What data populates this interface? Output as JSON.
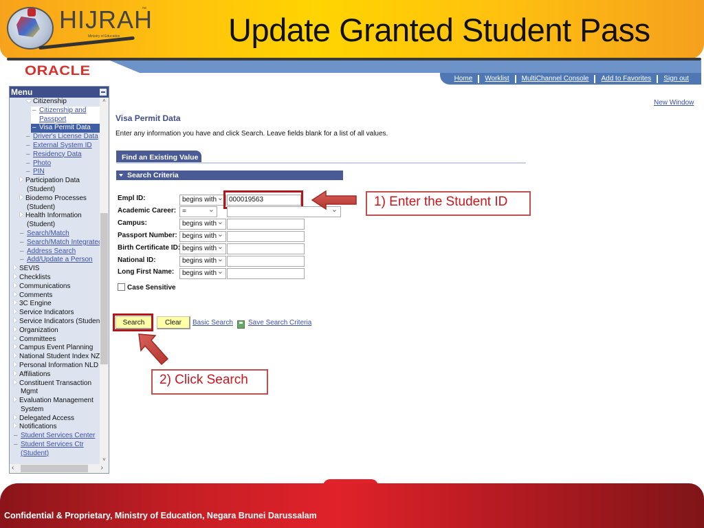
{
  "slide": {
    "title": "Update Granted Student Pass",
    "logo_text": "HIJRAH",
    "logo_tm": "™",
    "logo_subtitle": "Ministry of Education",
    "footer": "Confidential & Proprietary, Ministry of Education, Negara Brunei Darussalam"
  },
  "app": {
    "brand": "ORACLE",
    "nav_links": [
      "Home",
      "Worklist",
      "MultiChannel Console",
      "Add to Favorites",
      "Sign out"
    ],
    "new_window": "New Window"
  },
  "menu": {
    "title": "Menu",
    "items": [
      {
        "label": "Citizenship",
        "type": "open-folder",
        "indent": 2
      },
      {
        "label": "Citizenship and",
        "type": "link",
        "indent": 3,
        "white": true
      },
      {
        "label": "Passport",
        "type": "link-cont",
        "indent": 3,
        "white": true
      },
      {
        "label": "Visa Permit Data",
        "type": "selected",
        "indent": 3
      },
      {
        "label": "Driver's License Data",
        "type": "link",
        "indent": 2
      },
      {
        "label": "External System ID",
        "type": "link",
        "indent": 2
      },
      {
        "label": "Residency Data",
        "type": "link",
        "indent": 2
      },
      {
        "label": "Photo",
        "type": "link",
        "indent": 2
      },
      {
        "label": "PIN",
        "type": "link",
        "indent": 2
      },
      {
        "label": "Participation Data",
        "type": "folder",
        "indent": 1
      },
      {
        "label": "(Student)",
        "type": "cont",
        "indent": 1
      },
      {
        "label": "Biodemo Processes",
        "type": "folder",
        "indent": 1
      },
      {
        "label": "(Student)",
        "type": "cont",
        "indent": 1
      },
      {
        "label": "Health Information",
        "type": "folder",
        "indent": 1
      },
      {
        "label": "(Student)",
        "type": "cont",
        "indent": 1
      },
      {
        "label": "Search/Match",
        "type": "link",
        "indent": 1
      },
      {
        "label": "Search/Match Integrated",
        "type": "link",
        "indent": 1
      },
      {
        "label": "Address Search",
        "type": "link",
        "indent": 1
      },
      {
        "label": "Add/Update a Person",
        "type": "link",
        "indent": 1
      },
      {
        "label": "SEVIS",
        "type": "folder",
        "indent": 0
      },
      {
        "label": "Checklists",
        "type": "folder",
        "indent": 0
      },
      {
        "label": "Communications",
        "type": "folder",
        "indent": 0
      },
      {
        "label": "Comments",
        "type": "folder",
        "indent": 0
      },
      {
        "label": "3C Engine",
        "type": "folder",
        "indent": 0
      },
      {
        "label": "Service Indicators",
        "type": "folder",
        "indent": 0
      },
      {
        "label": "Service Indicators (Student)",
        "type": "folder",
        "indent": 0
      },
      {
        "label": "Organization",
        "type": "folder",
        "indent": 0
      },
      {
        "label": "Committees",
        "type": "folder",
        "indent": 0
      },
      {
        "label": "Campus Event Planning",
        "type": "folder",
        "indent": 0
      },
      {
        "label": "National Student Index NZL",
        "type": "folder",
        "indent": 0
      },
      {
        "label": "Personal Information NLD",
        "type": "folder",
        "indent": 0
      },
      {
        "label": "Affiliations",
        "type": "folder",
        "indent": 0
      },
      {
        "label": "Constituent Transaction",
        "type": "folder",
        "indent": 0
      },
      {
        "label": "Mgmt",
        "type": "cont",
        "indent": 0
      },
      {
        "label": "Evaluation Management",
        "type": "folder",
        "indent": 0
      },
      {
        "label": "System",
        "type": "cont",
        "indent": 0
      },
      {
        "label": "Delegated Access",
        "type": "folder",
        "indent": 0
      },
      {
        "label": "Notifications",
        "type": "folder",
        "indent": 0
      },
      {
        "label": "Student Services Center",
        "type": "link",
        "indent": 0
      },
      {
        "label": "Student Services Ctr",
        "type": "link",
        "indent": 0
      },
      {
        "label": "(Student)",
        "type": "link-cont",
        "indent": 0
      }
    ]
  },
  "page": {
    "title": "Visa Permit Data",
    "instructions": "Enter any information you have and click Search. Leave fields blank for a list of all values.",
    "tab": "Find an Existing Value",
    "section": "Search Criteria",
    "fields": [
      {
        "label": "Empl ID:",
        "operator": "begins with",
        "value": "000019563"
      },
      {
        "label": "Academic Career:",
        "operator": "=",
        "value": ""
      },
      {
        "label": "Campus:",
        "operator": "begins with",
        "value": ""
      },
      {
        "label": "Passport Number:",
        "operator": "begins with",
        "value": ""
      },
      {
        "label": "Birth Certificate ID:",
        "operator": "begins with",
        "value": ""
      },
      {
        "label": "National ID:",
        "operator": "begins with",
        "value": ""
      },
      {
        "label": "Long First Name:",
        "operator": "begins with",
        "value": ""
      }
    ],
    "case_sensitive": {
      "label": "Case Sensitive",
      "checked": false
    },
    "buttons": {
      "search": "Search",
      "clear": "Clear"
    },
    "links": {
      "basic_search": "Basic Search",
      "save_criteria": "Save Search Criteria"
    }
  },
  "callouts": {
    "step1": "1) Enter the Student ID",
    "step2": "2) Click Search",
    "color": "#c8161d"
  }
}
